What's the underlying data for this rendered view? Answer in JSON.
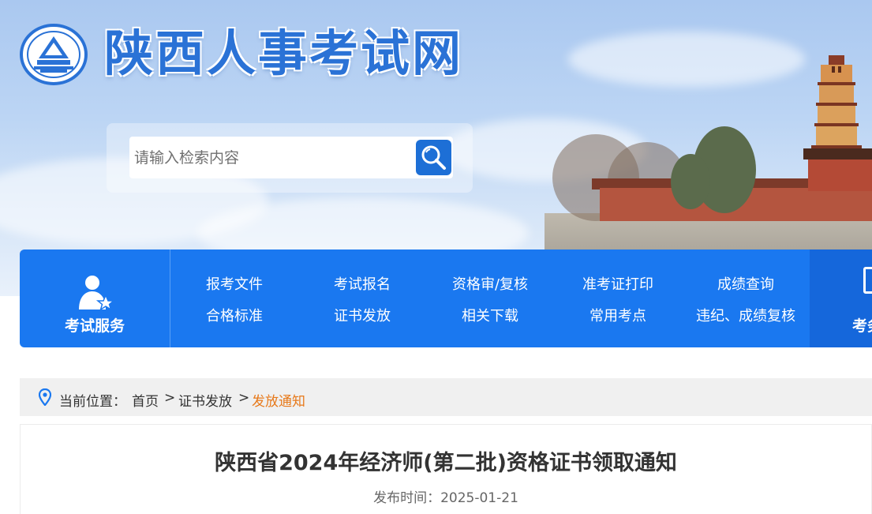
{
  "site": {
    "title": "陕西人事考试网"
  },
  "search": {
    "placeholder": "请输入检索内容"
  },
  "nav": {
    "service_label": "考试服务",
    "links": [
      "报考文件",
      "考试报名",
      "资格审/复核",
      "准考证打印",
      "成绩查询",
      "合格标准",
      "证书发放",
      "相关下载",
      "常用考点",
      "违纪、成绩复核"
    ],
    "right_label": "考务"
  },
  "breadcrumb": {
    "label": "当前位置：",
    "home": "首页",
    "sep": ">",
    "section": "证书发放",
    "current": "发放通知"
  },
  "article": {
    "title": "陕西省2024年经济师(第二批)资格证书领取通知",
    "date_label": "发布时间：",
    "date": "2025-01-21"
  },
  "colors": {
    "accent": "#1a78f0",
    "breadcrumb_current": "#e7791a"
  },
  "icons": [
    "logo-emblem",
    "search-icon",
    "user-star-icon",
    "location-pin-icon",
    "document-icon"
  ]
}
